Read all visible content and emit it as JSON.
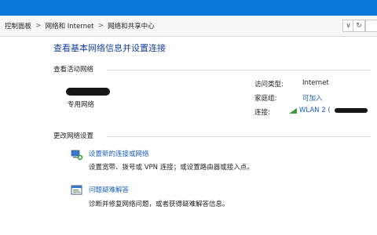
{
  "address_bar": {
    "crumbs": [
      "控制面板",
      "网络和 Internet",
      "网络和共享中心"
    ],
    "separator": ">",
    "dropdown_glyph": "∨",
    "refresh_glyph": "↻"
  },
  "main": {
    "title": "查看基本网络信息并设置连接",
    "active_networks": {
      "heading": "查看活动网络",
      "network_type": "专用网络",
      "properties": {
        "access_type_label": "访问类型:",
        "access_type_value": "Internet",
        "homegroup_label": "家庭组:",
        "homegroup_value": "可加入",
        "connections_label": "连接:",
        "connection_name": "WLAN 2 ("
      }
    },
    "change_settings": {
      "heading": "更改网络设置",
      "tasks": [
        {
          "link": "设置新的连接或网络",
          "description": "设置宽带、拨号或 VPN 连接；或设置路由器或接入点。",
          "icon": "new-connection-icon"
        },
        {
          "link": "问题疑难解答",
          "description": "诊断并修复网络问题，或者获得疑难解答信息。",
          "icon": "troubleshoot-icon"
        }
      ]
    }
  },
  "colors": {
    "title_strip": "#0a78d6",
    "heading_blue": "#1a3e9e",
    "link_blue": "#1b5ec2"
  }
}
